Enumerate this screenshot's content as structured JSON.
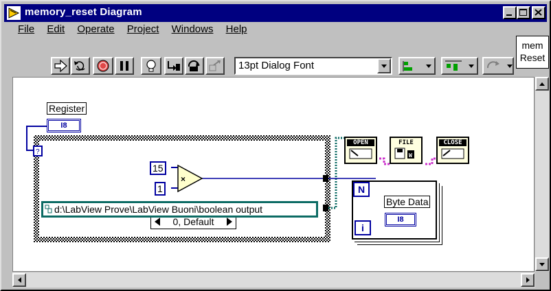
{
  "window": {
    "title": "memory_reset Diagram"
  },
  "menu": [
    "File",
    "Edit",
    "Operate",
    "Project",
    "Windows",
    "Help"
  ],
  "toolbar": {
    "font_select": "13pt Dialog Font",
    "icon_label_line1": "mem",
    "icon_label_line2": "Reset"
  },
  "diagram": {
    "register_label": "Register",
    "register_type": "I8",
    "case_selector": "0, Default",
    "const_15": "15",
    "const_1": "1",
    "path_constant": "d:\\LabView Prove\\LabView Buoni\\boolean output",
    "byte_data_label": "Byte Data",
    "byte_data_type": "I8",
    "loop_count": "N",
    "loop_index": "i",
    "open_vi": "OPEN",
    "file_vi": "FILE",
    "close_vi": "CLOSE"
  },
  "colors": {
    "title_bg": "#000080",
    "wire_int": "#0000a0",
    "wire_path": "#0c6b64",
    "wire_refnum": "#cc33cc",
    "vi_bg": "#ffffe0"
  }
}
